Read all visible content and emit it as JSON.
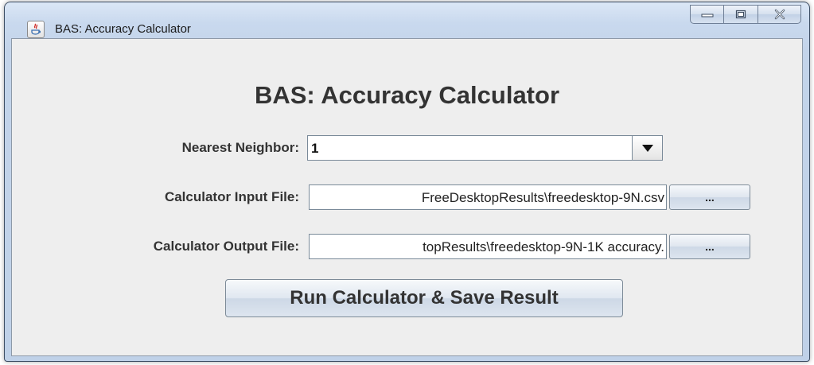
{
  "window": {
    "title": "BAS: Accuracy Calculator",
    "controls": {
      "minimize_icon": "minimize-icon",
      "maximize_icon": "maximize-icon",
      "close_icon": "close-icon"
    }
  },
  "form": {
    "heading": "BAS: Accuracy Calculator",
    "nearest_neighbor": {
      "label": "Nearest Neighbor:",
      "value": "1"
    },
    "input_file": {
      "label": "Calculator Input File:",
      "value": "FreeDesktopResults\\freedesktop-9N.csv",
      "browse_label": "..."
    },
    "output_file": {
      "label": "Calculator Output File:",
      "value": "topResults\\freedesktop-9N-1K accuracy.",
      "browse_label": "..."
    },
    "run_button": "Run Calculator & Save Result"
  }
}
